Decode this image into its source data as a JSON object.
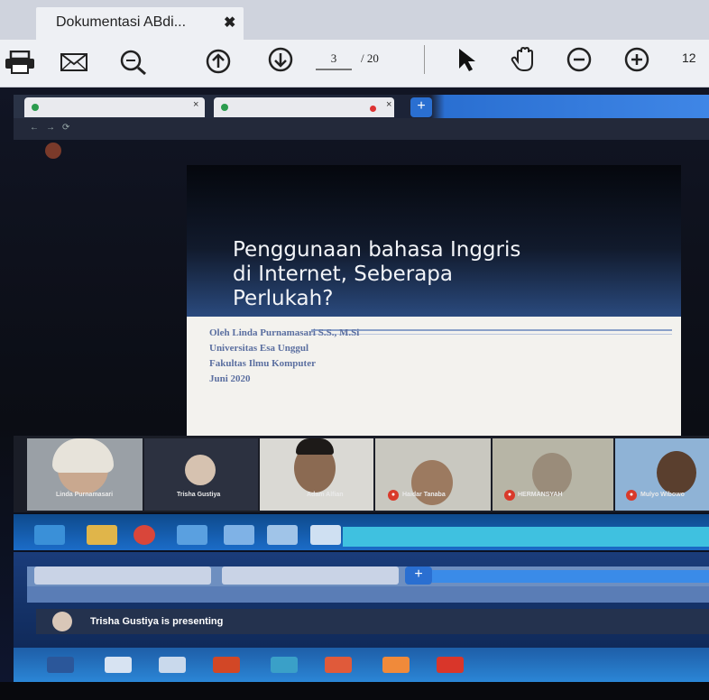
{
  "pdf_viewer": {
    "tab_title": "Dokumentasi ABdi...",
    "tab_close": "✖",
    "toolbar": {
      "print_icon": "printer-icon",
      "mail_icon": "envelope-icon",
      "search_icon": "magnifier-icon",
      "prev_icon": "arrow-up-circle-icon",
      "next_icon": "arrow-down-circle-icon",
      "current_page": "3",
      "total_pages": "/ 20",
      "cursor_icon": "cursor-icon",
      "hand_icon": "hand-icon",
      "zoom_out_icon": "minus-circle-icon",
      "zoom_in_icon": "plus-circle-icon",
      "zoom_value": "12"
    }
  },
  "screen": {
    "presenting_label": "Trisha Gustiya is presenting",
    "slide": {
      "title_lines": [
        "Penggunaan bahasa Inggris",
        "di Internet, Seberapa",
        "Perlukah?"
      ],
      "author": "Oleh Linda Purnamasari S.S., M.Si",
      "university": "Universitas Esa Unggul",
      "faculty": "Fakultas Ilmu Komputer",
      "date": "Juni 2020"
    },
    "participants": [
      {
        "name": "Linda Purnamasari"
      },
      {
        "name": "Trisha Gustiya"
      },
      {
        "name": "Adam Alfian"
      },
      {
        "name": "Haidar Tanaba"
      },
      {
        "name": "HERMANSYAH"
      },
      {
        "name": "Mulyo Wibowo"
      }
    ]
  },
  "colors": {
    "slide_head_dark": "#05070d",
    "slide_head_blue": "#2a4a7e",
    "slide_text": "#5b6fa0",
    "mic_off": "#d93a2b",
    "taskbar": "#1b6cc8"
  }
}
